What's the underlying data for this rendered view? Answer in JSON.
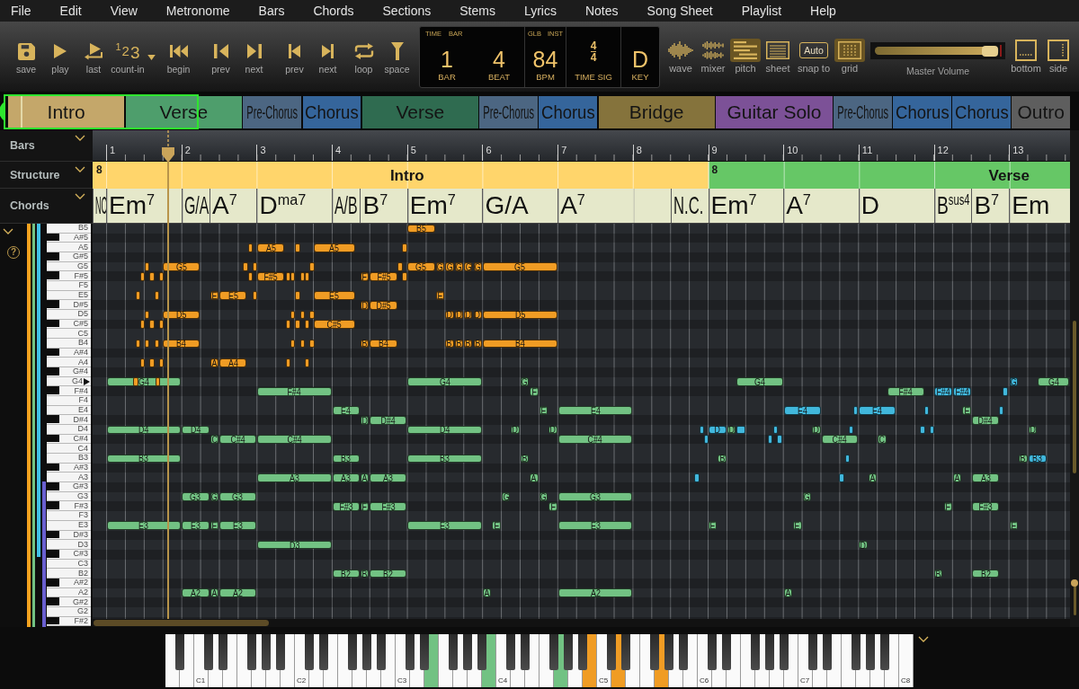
{
  "menu": [
    "File",
    "Edit",
    "View",
    "Metronome",
    "Bars",
    "Chords",
    "Sections",
    "Stems",
    "Lyrics",
    "Notes",
    "Song Sheet",
    "Playlist",
    "Help"
  ],
  "toolbar": {
    "transport": [
      {
        "kind": "save",
        "label": "save"
      },
      {
        "kind": "play",
        "label": "play"
      },
      {
        "kind": "last",
        "label": "last"
      },
      {
        "kind": "count-in",
        "label": "count-in",
        "icon_text": "123"
      },
      {
        "kind": "begin",
        "label": "begin"
      },
      {
        "kind": "prev-bar",
        "label": "prev"
      },
      {
        "kind": "next-bar",
        "label": "next"
      },
      {
        "kind": "prev-marker",
        "label": "prev"
      },
      {
        "kind": "next-marker",
        "label": "next"
      },
      {
        "kind": "loop",
        "label": "loop"
      },
      {
        "kind": "space",
        "label": "space"
      }
    ],
    "display": {
      "modes": [
        "TIME",
        "BAR"
      ],
      "counters": [
        {
          "value": "1",
          "label": "BAR"
        },
        {
          "value": "4",
          "label": "BEAT"
        }
      ],
      "tempo_modes": [
        "GLB",
        "INST"
      ],
      "tempo": {
        "value": "84",
        "label": "BPM"
      },
      "time_signature": {
        "upper": "4",
        "lower": "4",
        "label": "TIME SIG"
      },
      "key": {
        "value": "D",
        "label": "KEY"
      }
    },
    "views": [
      {
        "kind": "wave",
        "label": "wave",
        "selected": false
      },
      {
        "kind": "mixer",
        "label": "mixer",
        "selected": false
      },
      {
        "kind": "pitch",
        "label": "pitch",
        "selected": true
      },
      {
        "kind": "sheet",
        "label": "sheet",
        "selected": false
      },
      {
        "kind": "snap",
        "label": "snap to",
        "icon_text": "Auto",
        "selected": false
      },
      {
        "kind": "grid",
        "label": "grid",
        "selected": true
      }
    ],
    "master_volume": {
      "label": "Master Volume",
      "level": 0.93
    },
    "layout": [
      {
        "kind": "bottom",
        "label": "bottom"
      },
      {
        "kind": "side",
        "label": "side"
      }
    ]
  },
  "overview": {
    "sections": [
      {
        "label": "Intro",
        "color": "#c4a76a"
      },
      {
        "label": "Verse",
        "color": "#4e9e6c"
      },
      {
        "label": "Pre-Chorus",
        "color": "#4c6682"
      },
      {
        "label": "Chorus",
        "color": "#35659b"
      },
      {
        "label": "Verse",
        "color": "#2f6b50"
      },
      {
        "label": "Pre-Chorus",
        "color": "#4c6682"
      },
      {
        "label": "Chorus",
        "color": "#35659b"
      },
      {
        "label": "Bridge",
        "color": "#85733c"
      },
      {
        "label": "Guitar Solo",
        "color": "#7c5197"
      },
      {
        "label": "Pre-Chorus",
        "color": "#4c6682"
      },
      {
        "label": "Chorus",
        "color": "#35659b"
      },
      {
        "label": "Chorus",
        "color": "#35659b"
      },
      {
        "label": "Outro",
        "color": "#5e5e5e"
      }
    ]
  },
  "headers": [
    {
      "label": "Bars"
    },
    {
      "label": "Structure"
    },
    {
      "label": "Chords"
    }
  ],
  "timeline": {
    "bars": [
      "1",
      "2",
      "3",
      "4",
      "5",
      "6",
      "7",
      "8",
      "9",
      "10",
      "11",
      "12",
      "13"
    ],
    "structure": [
      {
        "label": "Intro",
        "bars": "8",
        "color": "#ffd56b"
      },
      {
        "label": "Verse",
        "bars": "8",
        "color": "#66c766"
      }
    ],
    "chords": [
      {
        "name": "NC"
      },
      {
        "name": "Em$^{7}$"
      },
      {
        "name": "G/A"
      },
      {
        "name": "A$^{7}$"
      },
      {
        "name": "D$^{ma7}$"
      },
      {
        "name": "A/B"
      },
      {
        "name": "B$^{7}$"
      },
      {
        "name": "Em$^{7}$"
      },
      {
        "name": "G/A"
      },
      {
        "name": "A$^{7}$"
      },
      {
        "name": "N.C."
      },
      {
        "name": "Em$^{7}$"
      },
      {
        "name": "A$^{7}$"
      },
      {
        "name": "D"
      },
      {
        "name": "B$^{sus4}$"
      },
      {
        "name": "B$^{7}$"
      },
      {
        "name": "Em"
      }
    ]
  },
  "piano_roll": {
    "help": "?",
    "lanes": [
      {
        "kind": "full",
        "color": "#f5a21f"
      },
      {
        "kind": "full",
        "color": "#72c283"
      },
      {
        "kind": "upper",
        "color": "#41c0e6"
      },
      {
        "kind": "lower",
        "color": "#6a5fd0"
      }
    ],
    "zoom_slider": {
      "level": 1
    },
    "rows": [
      {
        "label": "B5",
        "black": false,
        "marked": false,
        "notes": [
          {
            "color": "#f09c24",
            "label": "B5"
          }
        ]
      },
      {
        "label": "A#5",
        "black": true,
        "marked": false
      },
      {
        "label": "A5",
        "black": false,
        "marked": false,
        "notes": [
          {
            "color": "#f09c24"
          },
          {
            "color": "#f09c24",
            "label": "A5"
          },
          {
            "color": "#f09c24"
          },
          {
            "color": "#f09c24",
            "label": "A5"
          },
          {
            "color": "#f09c24"
          }
        ]
      },
      {
        "label": "G#5",
        "black": true,
        "marked": false
      },
      {
        "label": "G5",
        "black": false,
        "marked": false,
        "notes": [
          {
            "color": "#f09c24"
          },
          {
            "color": "#f09c24",
            "label": "G5"
          },
          {
            "color": "#f09c24"
          },
          {
            "color": "#f09c24"
          },
          {
            "color": "#f09c24"
          },
          {
            "color": "#f09c24"
          },
          {
            "color": "#f09c24",
            "label": "G5"
          },
          {
            "color": "#f09c24",
            "label": "G"
          },
          {
            "color": "#f09c24",
            "label": "G"
          },
          {
            "color": "#f09c24",
            "label": "G"
          },
          {
            "color": "#f09c24",
            "label": "G"
          },
          {
            "color": "#f09c24",
            "label": "G"
          },
          {
            "color": "#f09c24",
            "label": "G5"
          }
        ]
      },
      {
        "label": "F#5",
        "black": true,
        "marked": false,
        "notes": [
          {
            "color": "#f09c24"
          },
          {
            "color": "#f09c24"
          },
          {
            "color": "#f09c24"
          },
          {
            "color": "#f09c24"
          },
          {
            "color": "#f09c24",
            "label": "F#5"
          },
          {
            "color": "#f09c24"
          },
          {
            "color": "#f09c24"
          },
          {
            "color": "#f09c24"
          },
          {
            "color": "#f09c24"
          },
          {
            "color": "#f09c24",
            "label": "F"
          },
          {
            "color": "#f09c24",
            "label": "F#5"
          },
          {
            "color": "#f09c24"
          }
        ]
      },
      {
        "label": "F5",
        "black": false,
        "marked": false
      },
      {
        "label": "E5",
        "black": false,
        "marked": false,
        "notes": [
          {
            "color": "#f09c24"
          },
          {
            "color": "#f09c24"
          },
          {
            "color": "#f09c24",
            "label": "E"
          },
          {
            "color": "#f09c24",
            "label": "E5"
          },
          {
            "color": "#f09c24"
          },
          {
            "color": "#f09c24"
          },
          {
            "color": "#f09c24",
            "label": "E5"
          },
          {
            "color": "#f09c24",
            "label": "E"
          }
        ]
      },
      {
        "label": "D#5",
        "black": true,
        "marked": false,
        "notes": [
          {
            "color": "#f09c24",
            "label": "D"
          },
          {
            "color": "#f09c24",
            "label": "D#5"
          }
        ]
      },
      {
        "label": "D5",
        "black": false,
        "marked": false,
        "notes": [
          {
            "color": "#f09c24"
          },
          {
            "color": "#f09c24",
            "label": "D5"
          },
          {
            "color": "#f09c24"
          },
          {
            "color": "#f09c24"
          },
          {
            "color": "#f09c24"
          },
          {
            "color": "#f09c24",
            "label": "D"
          },
          {
            "color": "#f09c24",
            "label": "D"
          },
          {
            "color": "#f09c24",
            "label": "D"
          },
          {
            "color": "#f09c24",
            "label": "D"
          },
          {
            "color": "#f09c24",
            "label": "D5"
          }
        ]
      },
      {
        "label": "C#5",
        "black": true,
        "marked": false,
        "notes": [
          {
            "color": "#f09c24"
          },
          {
            "color": "#f09c24"
          },
          {
            "color": "#f09c24"
          },
          {
            "color": "#f09c24"
          },
          {
            "color": "#f09c24"
          },
          {
            "color": "#f09c24"
          },
          {
            "color": "#f09c24",
            "label": "C#5"
          }
        ]
      },
      {
        "label": "C5",
        "black": false,
        "marked": false
      },
      {
        "label": "B4",
        "black": false,
        "marked": false,
        "notes": [
          {
            "color": "#f09c24"
          },
          {
            "color": "#f09c24"
          },
          {
            "color": "#f09c24"
          },
          {
            "color": "#f09c24",
            "label": "B4"
          },
          {
            "color": "#f09c24"
          },
          {
            "color": "#f09c24"
          },
          {
            "color": "#f09c24"
          },
          {
            "color": "#f09c24",
            "label": "B"
          },
          {
            "color": "#f09c24",
            "label": "B4"
          },
          {
            "color": "#f09c24",
            "label": "B"
          },
          {
            "color": "#f09c24",
            "label": "B"
          },
          {
            "color": "#f09c24",
            "label": "B"
          },
          {
            "color": "#f09c24",
            "label": "B"
          },
          {
            "color": "#f09c24",
            "label": "B4"
          }
        ]
      },
      {
        "label": "A#4",
        "black": true,
        "marked": false
      },
      {
        "label": "A4",
        "black": false,
        "marked": false,
        "notes": [
          {
            "color": "#f09c24"
          },
          {
            "color": "#f09c24"
          },
          {
            "color": "#f09c24"
          },
          {
            "color": "#f09c24",
            "label": "A"
          },
          {
            "color": "#f09c24",
            "label": "A4"
          },
          {
            "color": "#f09c24"
          },
          {
            "color": "#f09c24"
          }
        ]
      },
      {
        "label": "G#4",
        "black": true,
        "marked": false
      },
      {
        "label": "G4",
        "black": false,
        "marked": true,
        "notes": [
          {
            "color": "#72c283",
            "label": "G4"
          },
          {
            "color": "#f09c24"
          },
          {
            "color": "#f09c24"
          },
          {
            "color": "#72c283",
            "label": "G4"
          },
          {
            "color": "#72c283",
            "label": "G"
          },
          {
            "color": "#72c283",
            "label": "G4"
          },
          {
            "color": "#41b7dc",
            "label": "G"
          },
          {
            "color": "#72c283",
            "label": "G4"
          }
        ]
      },
      {
        "label": "F#4",
        "black": true,
        "marked": false,
        "notes": [
          {
            "color": "#72c283",
            "label": "F#4"
          },
          {
            "color": "#72c283",
            "label": "F"
          },
          {
            "color": "#72c283",
            "label": "F#4"
          },
          {
            "color": "#41b7dc",
            "label": "F#4"
          },
          {
            "color": "#41b7dc",
            "label": "F#4"
          },
          {
            "color": "#41b7dc"
          }
        ]
      },
      {
        "label": "F4",
        "black": false,
        "marked": false
      },
      {
        "label": "E4",
        "black": false,
        "marked": false,
        "notes": [
          {
            "color": "#72c283",
            "label": "E4"
          },
          {
            "color": "#72c283",
            "label": "E"
          },
          {
            "color": "#72c283",
            "label": "E4"
          },
          {
            "color": "#41b7dc",
            "label": "E4"
          },
          {
            "color": "#41b7dc"
          },
          {
            "color": "#41b7dc",
            "label": "E4"
          },
          {
            "color": "#41b7dc"
          },
          {
            "color": "#72c283",
            "label": "E"
          },
          {
            "color": "#41b7dc"
          }
        ]
      },
      {
        "label": "D#4",
        "black": true,
        "marked": false,
        "notes": [
          {
            "color": "#72c283",
            "label": "D"
          },
          {
            "color": "#72c283",
            "label": "D#4"
          },
          {
            "color": "#72c283",
            "label": "D#4"
          }
        ]
      },
      {
        "label": "D4",
        "black": false,
        "marked": false,
        "notes": [
          {
            "color": "#72c283",
            "label": "D4"
          },
          {
            "color": "#72c283",
            "label": "D4"
          },
          {
            "color": "#72c283",
            "label": "D4"
          },
          {
            "color": "#72c283",
            "label": "D"
          },
          {
            "color": "#72c283",
            "label": "D"
          },
          {
            "color": "#41b7dc"
          },
          {
            "color": "#41b7dc",
            "label": "D"
          },
          {
            "color": "#72c283",
            "label": "D"
          },
          {
            "color": "#41b7dc"
          },
          {
            "color": "#41b7dc"
          },
          {
            "color": "#72c283",
            "label": "D"
          },
          {
            "color": "#41b7dc"
          },
          {
            "color": "#41b7dc"
          },
          {
            "color": "#41b7dc"
          },
          {
            "color": "#72c283",
            "label": "D"
          }
        ]
      },
      {
        "label": "C#4",
        "black": true,
        "marked": false,
        "notes": [
          {
            "color": "#72c283",
            "label": "C"
          },
          {
            "color": "#72c283",
            "label": "C#4"
          },
          {
            "color": "#72c283",
            "label": "C#4"
          },
          {
            "color": "#72c283",
            "label": "C#4"
          },
          {
            "color": "#41b7dc"
          },
          {
            "color": "#41b7dc"
          },
          {
            "color": "#41b7dc"
          },
          {
            "color": "#72c283",
            "label": "C#4"
          },
          {
            "color": "#72c283",
            "label": "C"
          }
        ]
      },
      {
        "label": "C4",
        "black": false,
        "marked": false
      },
      {
        "label": "B3",
        "black": false,
        "marked": false,
        "notes": [
          {
            "color": "#72c283",
            "label": "B3"
          },
          {
            "color": "#72c283",
            "label": "B3"
          },
          {
            "color": "#72c283",
            "label": "B3"
          },
          {
            "color": "#72c283",
            "label": "B"
          },
          {
            "color": "#72c283",
            "label": "B"
          },
          {
            "color": "#41b7dc"
          },
          {
            "color": "#72c283",
            "label": "B"
          },
          {
            "color": "#41b7dc",
            "label": "B3"
          }
        ]
      },
      {
        "label": "A#3",
        "black": true,
        "marked": false
      },
      {
        "label": "A3",
        "black": false,
        "marked": false,
        "notes": [
          {
            "color": "#72c283",
            "label": "A3"
          },
          {
            "color": "#72c283",
            "label": "A3"
          },
          {
            "color": "#72c283",
            "label": "A"
          },
          {
            "color": "#72c283",
            "label": "A3"
          },
          {
            "color": "#72c283",
            "label": "A"
          },
          {
            "color": "#41b7dc"
          },
          {
            "color": "#41b7dc"
          },
          {
            "color": "#72c283",
            "label": "A"
          },
          {
            "color": "#72c283",
            "label": "A"
          },
          {
            "color": "#72c283",
            "label": "A3"
          }
        ]
      },
      {
        "label": "G#3",
        "black": true,
        "marked": false
      },
      {
        "label": "G3",
        "black": false,
        "marked": false,
        "notes": [
          {
            "color": "#72c283",
            "label": "G3"
          },
          {
            "color": "#72c283",
            "label": "G"
          },
          {
            "color": "#72c283",
            "label": "G3"
          },
          {
            "color": "#72c283",
            "label": "G"
          },
          {
            "color": "#72c283",
            "label": "G"
          },
          {
            "color": "#72c283",
            "label": "G3"
          },
          {
            "color": "#72c283",
            "label": "G"
          }
        ]
      },
      {
        "label": "F#3",
        "black": true,
        "marked": false,
        "notes": [
          {
            "color": "#72c283",
            "label": "F#3"
          },
          {
            "color": "#72c283",
            "label": "F"
          },
          {
            "color": "#72c283",
            "label": "F#3"
          },
          {
            "color": "#72c283",
            "label": "F"
          },
          {
            "color": "#72c283",
            "label": "F"
          },
          {
            "color": "#72c283",
            "label": "F#3"
          }
        ]
      },
      {
        "label": "F3",
        "black": false,
        "marked": false
      },
      {
        "label": "E3",
        "black": false,
        "marked": false,
        "notes": [
          {
            "color": "#72c283",
            "label": "E3"
          },
          {
            "color": "#72c283",
            "label": "E3"
          },
          {
            "color": "#72c283",
            "label": "E"
          },
          {
            "color": "#72c283",
            "label": "E3"
          },
          {
            "color": "#72c283",
            "label": "E3"
          },
          {
            "color": "#72c283",
            "label": "E"
          },
          {
            "color": "#72c283",
            "label": "E3"
          },
          {
            "color": "#72c283",
            "label": "E"
          },
          {
            "color": "#72c283",
            "label": "E"
          },
          {
            "color": "#72c283",
            "label": "E"
          }
        ]
      },
      {
        "label": "D#3",
        "black": true,
        "marked": false
      },
      {
        "label": "D3",
        "black": false,
        "marked": false,
        "notes": [
          {
            "color": "#72c283",
            "label": "D3"
          },
          {
            "color": "#72c283",
            "label": "D"
          }
        ]
      },
      {
        "label": "C#3",
        "black": true,
        "marked": false
      },
      {
        "label": "C3",
        "black": false,
        "marked": false
      },
      {
        "label": "B2",
        "black": false,
        "marked": false,
        "notes": [
          {
            "color": "#72c283",
            "label": "B2"
          },
          {
            "color": "#72c283",
            "label": "B"
          },
          {
            "color": "#72c283",
            "label": "B2"
          },
          {
            "color": "#72c283",
            "label": "B"
          },
          {
            "color": "#72c283",
            "label": "B2"
          }
        ]
      },
      {
        "label": "A#2",
        "black": true,
        "marked": false
      },
      {
        "label": "A2",
        "black": false,
        "marked": false,
        "notes": [
          {
            "color": "#72c283",
            "label": "A2"
          },
          {
            "color": "#72c283",
            "label": "A"
          },
          {
            "color": "#72c283",
            "label": "A2"
          },
          {
            "color": "#72c283",
            "label": "A"
          },
          {
            "color": "#72c283",
            "label": "A2"
          },
          {
            "color": "#72c283",
            "label": "A"
          }
        ]
      },
      {
        "label": "G#2",
        "black": true,
        "marked": false
      },
      {
        "label": "G2",
        "black": false,
        "marked": false
      },
      {
        "label": "F#2",
        "black": true,
        "marked": false
      }
    ]
  },
  "keyboard": {
    "keys": [
      {
        "black": false,
        "pressed": false
      },
      {
        "black": true,
        "pressed": false
      },
      {
        "black": false,
        "pressed": false
      },
      {
        "black": false,
        "pressed": false,
        "label": "C1"
      },
      {
        "black": true,
        "pressed": false
      },
      {
        "black": false,
        "pressed": false
      },
      {
        "black": true,
        "pressed": false
      },
      {
        "black": false,
        "pressed": false
      },
      {
        "black": false,
        "pressed": false
      },
      {
        "black": true,
        "pressed": false
      },
      {
        "black": false,
        "pressed": false
      },
      {
        "black": true,
        "pressed": false
      },
      {
        "black": false,
        "pressed": false
      },
      {
        "black": true,
        "pressed": false
      },
      {
        "black": false,
        "pressed": false
      },
      {
        "black": false,
        "pressed": false,
        "label": "C2"
      },
      {
        "black": true,
        "pressed": false
      },
      {
        "black": false,
        "pressed": false
      },
      {
        "black": true,
        "pressed": false
      },
      {
        "black": false,
        "pressed": false
      },
      {
        "black": false,
        "pressed": false
      },
      {
        "black": true,
        "pressed": false
      },
      {
        "black": false,
        "pressed": false
      },
      {
        "black": true,
        "pressed": false
      },
      {
        "black": false,
        "pressed": false
      },
      {
        "black": true,
        "pressed": false
      },
      {
        "black": false,
        "pressed": false
      },
      {
        "black": false,
        "pressed": false,
        "label": "C3"
      },
      {
        "black": true,
        "pressed": false
      },
      {
        "black": false,
        "pressed": false
      },
      {
        "black": true,
        "pressed": false
      },
      {
        "black": false,
        "pressed": true,
        "color": "#72c283"
      },
      {
        "black": false,
        "pressed": false
      },
      {
        "black": true,
        "pressed": false
      },
      {
        "black": false,
        "pressed": false
      },
      {
        "black": true,
        "pressed": false
      },
      {
        "black": false,
        "pressed": false
      },
      {
        "black": true,
        "pressed": false
      },
      {
        "black": false,
        "pressed": true,
        "color": "#72c283"
      },
      {
        "black": false,
        "pressed": false,
        "label": "C4"
      },
      {
        "black": true,
        "pressed": false
      },
      {
        "black": false,
        "pressed": false
      },
      {
        "black": true,
        "pressed": false
      },
      {
        "black": false,
        "pressed": false
      },
      {
        "black": false,
        "pressed": false
      },
      {
        "black": true,
        "pressed": false
      },
      {
        "black": false,
        "pressed": true,
        "color": "#72c283"
      },
      {
        "black": true,
        "pressed": false
      },
      {
        "black": false,
        "pressed": false
      },
      {
        "black": true,
        "pressed": false
      },
      {
        "black": false,
        "pressed": true,
        "color": "#f09c24"
      },
      {
        "black": false,
        "pressed": false,
        "label": "C5"
      },
      {
        "black": true,
        "pressed": false
      },
      {
        "black": false,
        "pressed": true,
        "color": "#f09c24"
      },
      {
        "black": true,
        "pressed": false
      },
      {
        "black": false,
        "pressed": false
      },
      {
        "black": false,
        "pressed": false
      },
      {
        "black": true,
        "pressed": false
      },
      {
        "black": false,
        "pressed": true,
        "color": "#f09c24"
      },
      {
        "black": true,
        "pressed": false
      },
      {
        "black": false,
        "pressed": false
      },
      {
        "black": true,
        "pressed": false
      },
      {
        "black": false,
        "pressed": false
      },
      {
        "black": false,
        "pressed": false,
        "label": "C6"
      },
      {
        "black": true,
        "pressed": false
      },
      {
        "black": false,
        "pressed": false
      },
      {
        "black": true,
        "pressed": false
      },
      {
        "black": false,
        "pressed": false
      },
      {
        "black": false,
        "pressed": false
      },
      {
        "black": true,
        "pressed": false
      },
      {
        "black": false,
        "pressed": false
      },
      {
        "black": true,
        "pressed": false
      },
      {
        "black": false,
        "pressed": false
      },
      {
        "black": true,
        "pressed": false
      },
      {
        "black": false,
        "pressed": false
      },
      {
        "black": false,
        "pressed": false,
        "label": "C7"
      },
      {
        "black": true,
        "pressed": false
      },
      {
        "black": false,
        "pressed": false
      },
      {
        "black": true,
        "pressed": false
      },
      {
        "black": false,
        "pressed": false
      },
      {
        "black": false,
        "pressed": false
      },
      {
        "black": true,
        "pressed": false
      },
      {
        "black": false,
        "pressed": false
      },
      {
        "black": true,
        "pressed": false
      },
      {
        "black": false,
        "pressed": false
      },
      {
        "black": true,
        "pressed": false
      },
      {
        "black": false,
        "pressed": false
      },
      {
        "black": false,
        "pressed": false,
        "label": "C8"
      }
    ]
  }
}
